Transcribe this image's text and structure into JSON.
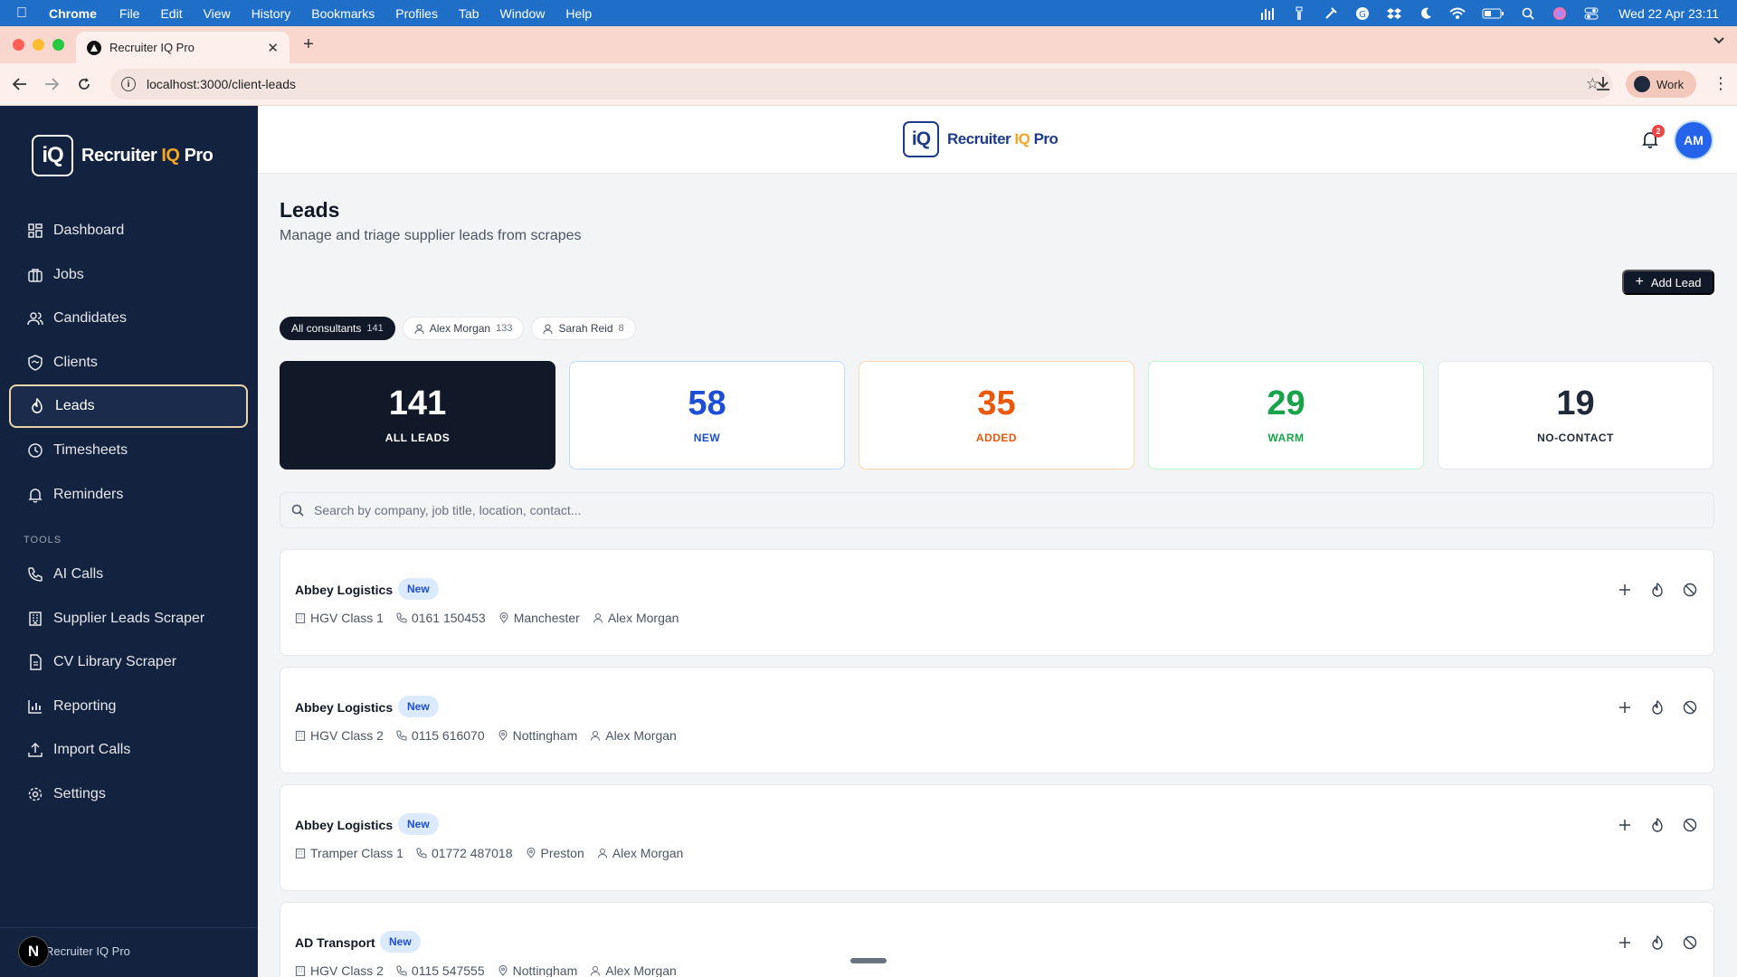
{
  "menubar": {
    "app": "Chrome",
    "items": [
      "File",
      "Edit",
      "View",
      "History",
      "Bookmarks",
      "Profiles",
      "Tab",
      "Window",
      "Help"
    ],
    "clock": "Wed 22 Apr  23:11"
  },
  "browser": {
    "tab_title": "Recruiter IQ Pro",
    "url": "localhost:3000/client-leads",
    "profile": "Work"
  },
  "brand": {
    "logo_mark": "iQ",
    "name_prefix": "Recruiter",
    "name_iq": "IQ",
    "name_suffix": "Pro"
  },
  "sidebar": {
    "items": [
      {
        "label": "Dashboard",
        "icon": "dashboard-icon"
      },
      {
        "label": "Jobs",
        "icon": "briefcase-icon"
      },
      {
        "label": "Candidates",
        "icon": "users-icon"
      },
      {
        "label": "Clients",
        "icon": "shield-icon"
      },
      {
        "label": "Leads",
        "icon": "flame-icon",
        "active": true
      },
      {
        "label": "Timesheets",
        "icon": "clock-icon"
      },
      {
        "label": "Reminders",
        "icon": "bell-icon"
      }
    ],
    "tools_label": "TOOLS",
    "tools": [
      {
        "label": "AI Calls",
        "icon": "phone-icon"
      },
      {
        "label": "Supplier Leads Scraper",
        "icon": "building-icon"
      },
      {
        "label": "CV Library Scraper",
        "icon": "file-icon"
      },
      {
        "label": "Reporting",
        "icon": "chart-icon"
      },
      {
        "label": "Import Calls",
        "icon": "upload-icon"
      },
      {
        "label": "Settings",
        "icon": "gear-icon"
      }
    ],
    "footer_badge": "N",
    "footer_text": "Recruiter IQ Pro"
  },
  "header": {
    "notification_count": "2",
    "avatar_initials": "AM"
  },
  "page": {
    "title": "Leads",
    "subtitle": "Manage and triage supplier leads from scrapes",
    "add_button": "Add Lead",
    "search_placeholder": "Search by company, job title, location, contact..."
  },
  "filters": [
    {
      "label": "All consultants",
      "count": "141",
      "active": true
    },
    {
      "label": "Alex Morgan",
      "count": "133"
    },
    {
      "label": "Sarah Reid",
      "count": "8"
    }
  ],
  "stats": [
    {
      "value": "141",
      "label": "ALL LEADS",
      "color": "#111827"
    },
    {
      "value": "58",
      "label": "NEW",
      "color": "#1d4ed8"
    },
    {
      "value": "35",
      "label": "ADDED",
      "color": "#ea580c"
    },
    {
      "value": "29",
      "label": "WARM",
      "color": "#16a34a"
    },
    {
      "value": "19",
      "label": "NO-CONTACT",
      "color": "#1f2937"
    }
  ],
  "leads": [
    {
      "company": "Abbey Logistics",
      "status": "New",
      "job": "HGV Class 1",
      "phone": "0161 150453",
      "location": "Manchester",
      "consultant": "Alex Morgan"
    },
    {
      "company": "Abbey Logistics",
      "status": "New",
      "job": "HGV Class 2",
      "phone": "0115 616070",
      "location": "Nottingham",
      "consultant": "Alex Morgan"
    },
    {
      "company": "Abbey Logistics",
      "status": "New",
      "job": "Tramper Class 1",
      "phone": "01772 487018",
      "location": "Preston",
      "consultant": "Alex Morgan"
    },
    {
      "company": "AD Transport",
      "status": "New",
      "job": "HGV Class 2",
      "phone": "0115 547555",
      "location": "Nottingham",
      "consultant": "Alex Morgan"
    }
  ]
}
